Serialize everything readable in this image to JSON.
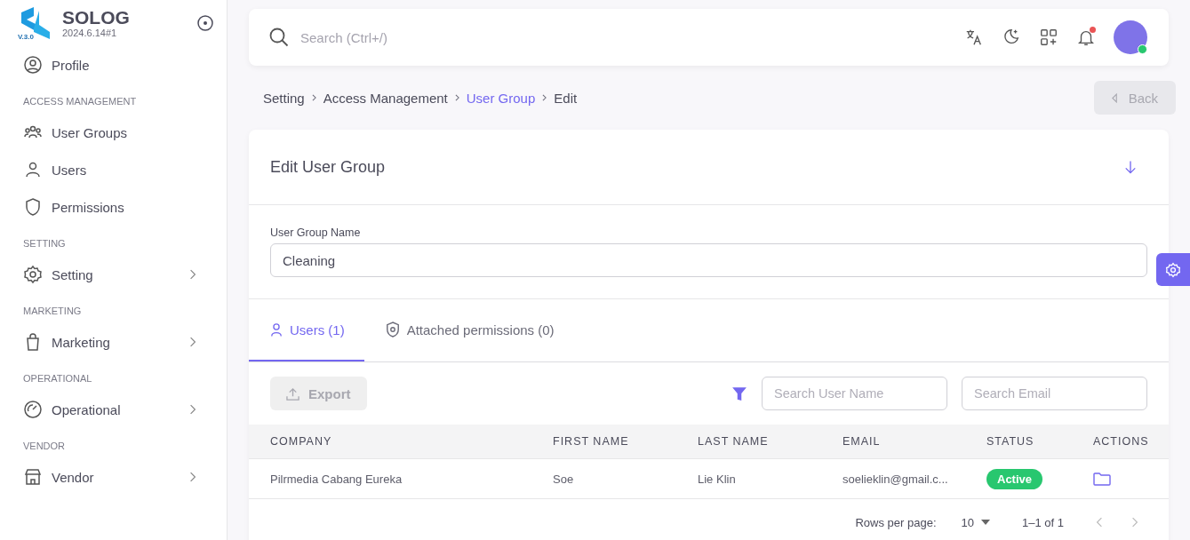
{
  "sidebar": {
    "brand": "SOLOG",
    "version": "2024.6.14#1",
    "logo_badge": "V.3.0",
    "profile": {
      "label": "Profile"
    },
    "sections": [
      {
        "heading": "ACCESS MANAGEMENT",
        "items": [
          {
            "label": "User Groups",
            "expandable": false
          },
          {
            "label": "Users",
            "expandable": false
          },
          {
            "label": "Permissions",
            "expandable": false
          }
        ]
      },
      {
        "heading": "SETTING",
        "items": [
          {
            "label": "Setting",
            "expandable": true
          }
        ]
      },
      {
        "heading": "MARKETING",
        "items": [
          {
            "label": "Marketing",
            "expandable": true
          }
        ]
      },
      {
        "heading": "OPERATIONAL",
        "items": [
          {
            "label": "Operational",
            "expandable": true
          }
        ]
      },
      {
        "heading": "VENDOR",
        "items": [
          {
            "label": "Vendor",
            "expandable": true
          }
        ]
      }
    ]
  },
  "topbar": {
    "search": {
      "placeholder": "Search (Ctrl+/)"
    },
    "notifications_unread": true,
    "user_online": true
  },
  "breadcrumb": [
    {
      "label": "Setting",
      "kind": "text"
    },
    {
      "label": "Access Management",
      "kind": "text"
    },
    {
      "label": "User Group",
      "kind": "link"
    },
    {
      "label": "Edit",
      "kind": "text"
    }
  ],
  "back_button": {
    "label": "Back",
    "disabled": true
  },
  "card": {
    "title": "Edit User Group",
    "field": {
      "label": "User Group Name",
      "value": "Cleaning"
    },
    "tabs": [
      {
        "label": "Users (1)",
        "selected": true
      },
      {
        "label": "Attached permissions (0)",
        "selected": false
      }
    ],
    "export_button": {
      "label": "Export",
      "disabled": true
    },
    "filters": [
      {
        "placeholder": "Search User Name"
      },
      {
        "placeholder": "Search Email"
      }
    ],
    "table": {
      "columns": [
        "COMPANY",
        "FIRST NAME",
        "LAST NAME",
        "EMAIL",
        "STATUS",
        "ACTIONS"
      ],
      "rows": [
        {
          "cells": [
            "Pilrmedia Cabang Eureka",
            "Soe",
            "Lie Klin",
            "soelieklin@gmail.c..."
          ],
          "status": {
            "label": "Active",
            "color": "#28c76f"
          }
        }
      ]
    },
    "pagination": {
      "rows_label": "Rows per page:",
      "rows_value": "10",
      "range": "1–1 of 1"
    }
  }
}
